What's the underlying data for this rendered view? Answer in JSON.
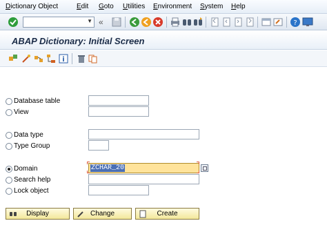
{
  "menu": {
    "items": [
      {
        "first": "D",
        "rest": "ictionary Object"
      },
      {
        "first": "E",
        "rest": "dit"
      },
      {
        "first": "G",
        "rest": "oto"
      },
      {
        "first": "U",
        "rest": "tilities"
      },
      {
        "first": "E",
        "rest": "nvironment"
      },
      {
        "first": "S",
        "rest": "ystem"
      },
      {
        "first": "H",
        "rest": "elp"
      }
    ]
  },
  "toolbar": {
    "command_field_value": "",
    "icons": [
      "enter-icon",
      "save-icon",
      "back-icon",
      "exit-icon",
      "cancel-icon",
      "print-icon",
      "find-icon",
      "find-next-icon",
      "first-page-icon",
      "previous-page-icon",
      "next-page-icon",
      "last-page-icon",
      "new-session-icon",
      "shortcut-icon",
      "help-icon",
      "layout-icon"
    ]
  },
  "title": "ABAP Dictionary: Initial Screen",
  "app_toolbar": {
    "icons": [
      "other-object-icon",
      "edit-icon",
      "where-used-icon",
      "hierarchy-icon",
      "info-icon",
      "delete-icon",
      "copy-icon"
    ]
  },
  "form": {
    "groups": [
      {
        "label": "Database table",
        "value": "",
        "selected": false
      },
      {
        "label": "View",
        "value": "",
        "selected": false
      },
      {
        "label": "Data type",
        "value": "",
        "selected": false
      },
      {
        "label": "Type Group",
        "value": "",
        "selected": false
      },
      {
        "label": "Domain",
        "value": "ZCHAR_20",
        "selected": true
      },
      {
        "label": "Search help",
        "value": "",
        "selected": false
      },
      {
        "label": "Lock object",
        "value": "",
        "selected": false
      }
    ]
  },
  "buttons": {
    "display": "Display",
    "change": "Change",
    "create": "Create"
  },
  "colors": {
    "active_field": "#ffe39b",
    "selection": "#4a6fb5",
    "button_bg": "#f3e79a",
    "title": "#1b2c48"
  }
}
